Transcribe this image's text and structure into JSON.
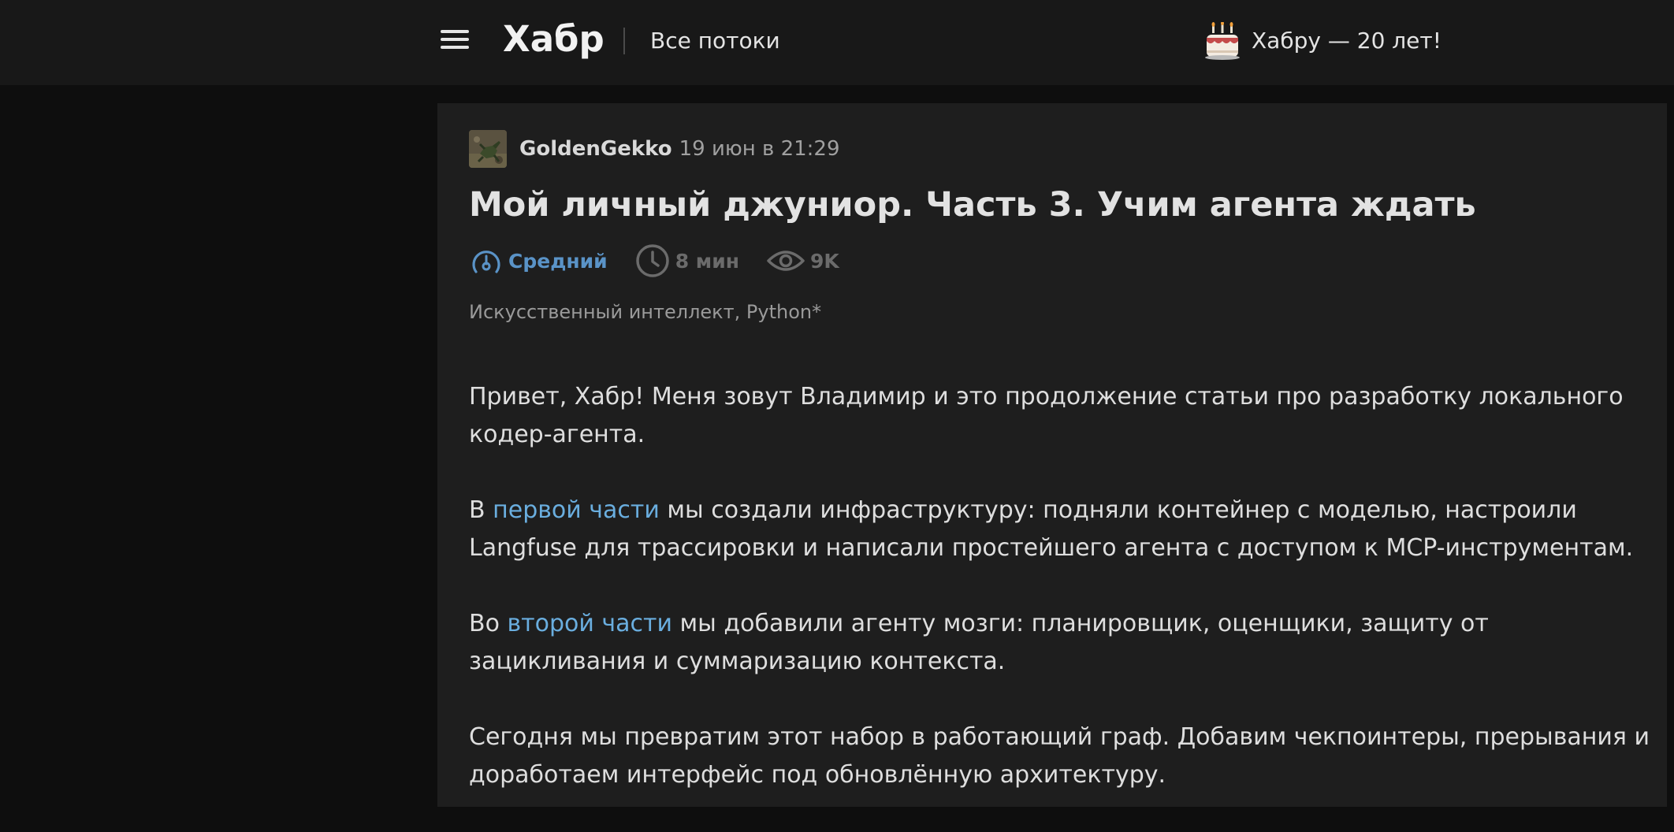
{
  "header": {
    "logo": "Хабр",
    "streams_label": "Все потоки",
    "anniversary_text": "Хабру — 20 лет!",
    "icons": {
      "menu": "hamburger-menu-icon",
      "cake": "birthday-cake-icon"
    }
  },
  "article": {
    "author": "GoldenGekko",
    "date": "19 июн в 21:29",
    "title": "Мой личный джуниор. Часть 3. Учим агента ждать",
    "stats": {
      "level": "Средний",
      "reading_time": "8 мин",
      "views": "9K"
    },
    "hubs": "Искусственный интеллект, Python*",
    "paragraphs": {
      "p1": "Привет, Хабр! Меня зовут Владимир и это продолжение статьи про разработку локального кодер-агента.",
      "p2_before": "В ",
      "p2_link": "первой части",
      "p2_after": " мы создали инфраструктуру: подняли контейнер с моделью, настроили Langfuse для трассировки и написали простейшего агента с доступом к MCP-инструментам.",
      "p3_before": "Во ",
      "p3_link": "второй части",
      "p3_after": " мы добавили агенту мозги: планировщик, оценщики, защиту от зацикливания и суммаризацию контекста.",
      "p4": "Сегодня мы превратим этот набор в работающий граф. Добавим чекпоинтеры, прерывания и доработаем интерфейс под обновлённую архитектуру."
    }
  },
  "colors": {
    "page_bg": "#0e0e0e",
    "header_bg": "#181818",
    "card_bg": "#1e1e1e",
    "link": "#6aaedf",
    "level": "#5a93c7",
    "muted": "#6b6b6b"
  }
}
